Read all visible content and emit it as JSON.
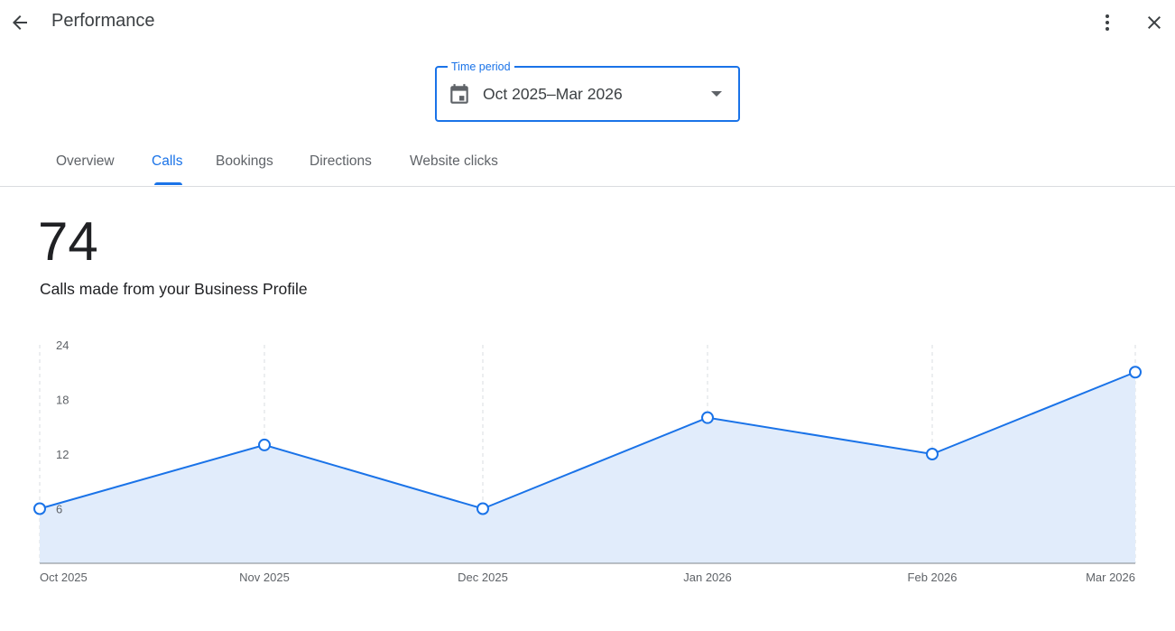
{
  "header": {
    "title": "Performance"
  },
  "time_period": {
    "label": "Time period",
    "value": "Oct 2025–Mar 2026"
  },
  "tabs": [
    {
      "label": "Overview",
      "active": false
    },
    {
      "label": "Calls",
      "active": true
    },
    {
      "label": "Bookings",
      "active": false
    },
    {
      "label": "Directions",
      "active": false
    },
    {
      "label": "Website clicks",
      "active": false
    }
  ],
  "metric": {
    "value": "74",
    "description": "Calls made from your Business Profile"
  },
  "colors": {
    "accent": "#1a73e8",
    "area_fill": "#e1ecfb"
  },
  "chart_data": {
    "type": "area",
    "categories": [
      "Oct 2025",
      "Nov 2025",
      "Dec 2025",
      "Jan 2026",
      "Feb 2026",
      "Mar 2026"
    ],
    "values": [
      6,
      13,
      6,
      16,
      12,
      21
    ],
    "ylim": [
      0,
      24
    ],
    "yticks": [
      "6",
      "12",
      "18",
      "24"
    ],
    "grid": "vertical dashed",
    "title": "",
    "xlabel": "",
    "ylabel": ""
  }
}
